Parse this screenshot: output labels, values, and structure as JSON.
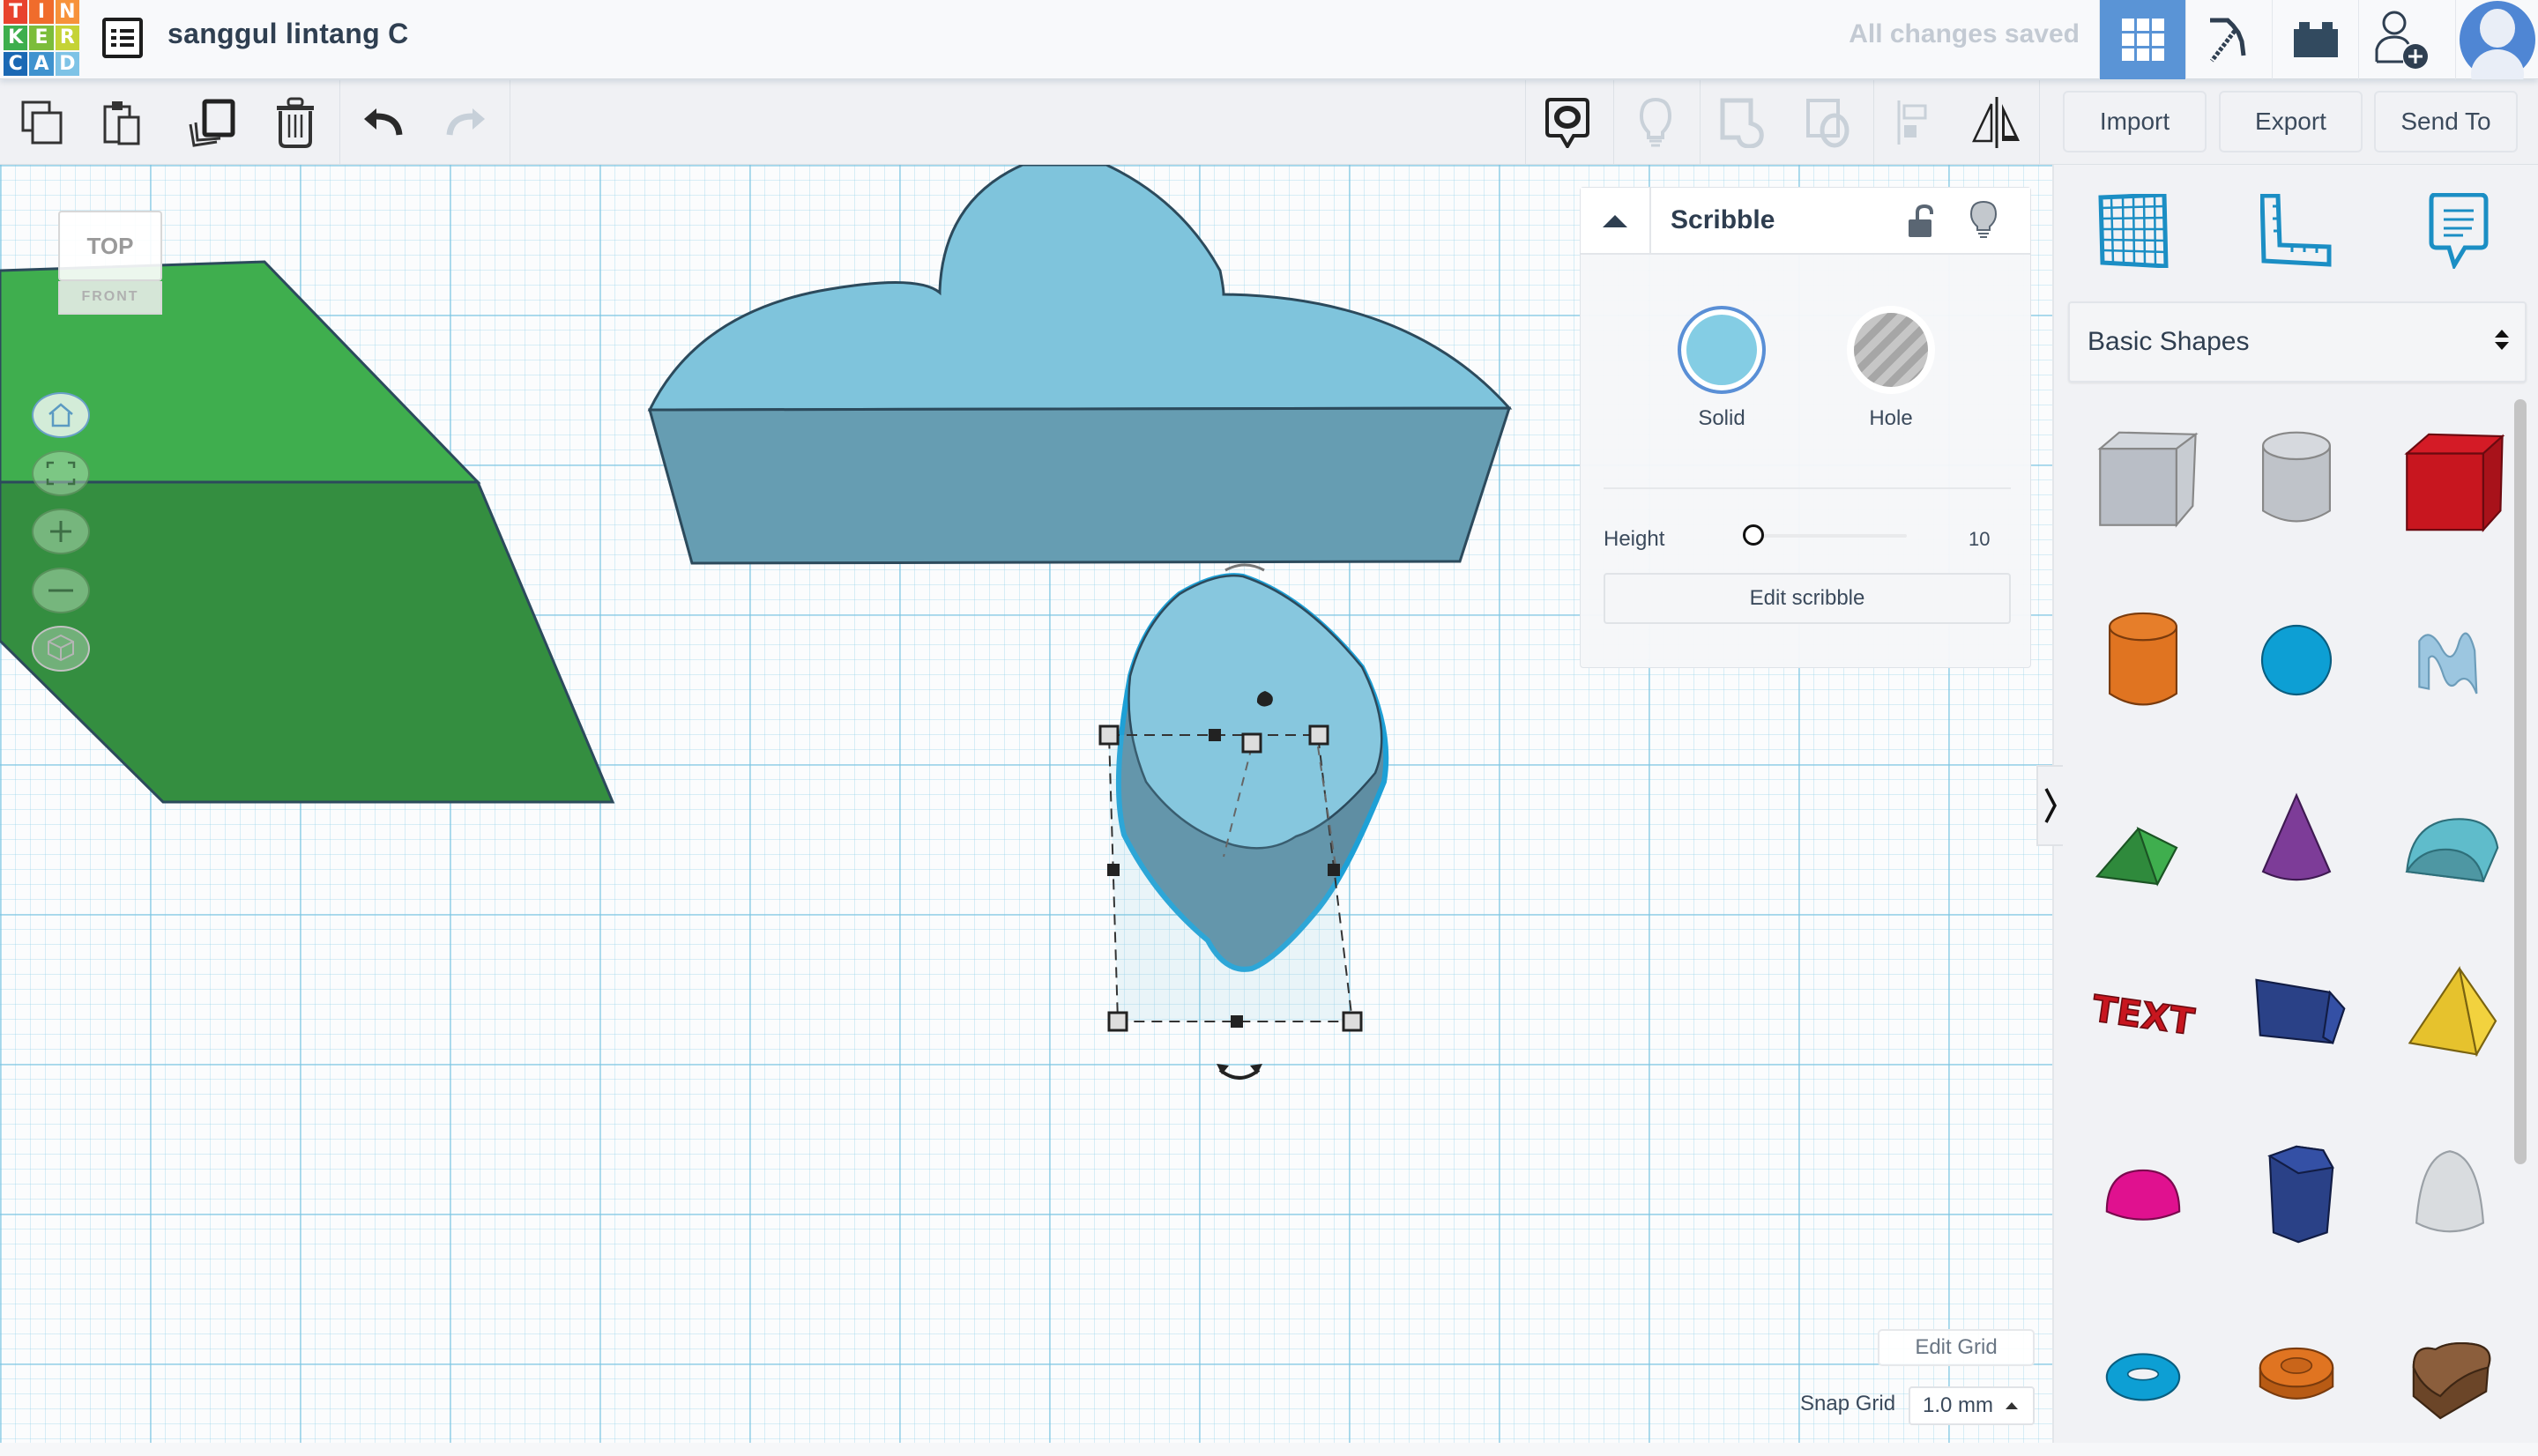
{
  "app": {
    "logo_letters": [
      "T",
      "I",
      "N",
      "K",
      "E",
      "R",
      "C",
      "A",
      "D"
    ],
    "logo_colors": [
      "#e8432e",
      "#f06c2c",
      "#f7923a",
      "#3dae4d",
      "#7cbd3b",
      "#c5d336",
      "#1a68b4",
      "#3f93cf",
      "#7ec3e6"
    ],
    "design_title": "sanggul lintang C",
    "save_status": "All changes saved",
    "accent_color": "#5a94d6"
  },
  "header_buttons": [
    {
      "name": "3d-design-view",
      "icon": "grid-icon",
      "active": true
    },
    {
      "name": "blocks-view",
      "icon": "pickaxe-icon",
      "active": false
    },
    {
      "name": "bricks-view",
      "icon": "brick-icon",
      "active": false
    },
    {
      "name": "invite-user",
      "icon": "add-user-icon",
      "active": false
    },
    {
      "name": "profile",
      "icon": "avatar-icon",
      "active": false
    }
  ],
  "toolbar": {
    "left_tools": [
      {
        "name": "copy",
        "icon": "copy-icon",
        "enabled": true
      },
      {
        "name": "paste",
        "icon": "paste-icon",
        "enabled": true
      },
      {
        "name": "duplicate",
        "icon": "duplicate-icon",
        "enabled": true
      },
      {
        "name": "delete",
        "icon": "trash-icon",
        "enabled": true
      },
      {
        "name": "undo",
        "icon": "undo-icon",
        "enabled": true
      },
      {
        "name": "redo",
        "icon": "redo-icon",
        "enabled": false
      }
    ],
    "right_tools": [
      {
        "name": "notes",
        "icon": "note-eye-icon",
        "enabled": true
      },
      {
        "name": "show-all",
        "icon": "lightbulb-icon",
        "enabled": false
      },
      {
        "name": "group",
        "icon": "group-icon",
        "enabled": false
      },
      {
        "name": "ungroup",
        "icon": "ungroup-icon",
        "enabled": false
      },
      {
        "name": "align",
        "icon": "align-icon",
        "enabled": false
      },
      {
        "name": "mirror",
        "icon": "mirror-icon",
        "enabled": true
      }
    ],
    "import_label": "Import",
    "export_label": "Export",
    "send_to_label": "Send To"
  },
  "viewcube": {
    "top_label": "TOP",
    "front_label": "FRONT"
  },
  "view_controls": [
    {
      "name": "home-view",
      "icon": "home-icon"
    },
    {
      "name": "fit-view",
      "icon": "fit-icon"
    },
    {
      "name": "zoom-in",
      "icon": "plus-icon"
    },
    {
      "name": "zoom-out",
      "icon": "minus-icon"
    },
    {
      "name": "ortho-view",
      "icon": "cube-icon"
    }
  ],
  "inspector": {
    "shape_name": "Scribble",
    "solid_label": "Solid",
    "hole_label": "Hole",
    "solid_color": "#84cde4",
    "selected_mode": "Solid",
    "height_label": "Height",
    "height_value": "10",
    "height_slider_fraction": 0.0,
    "edit_button_label": "Edit scribble",
    "locked": false
  },
  "grid_controls": {
    "edit_grid_label": "Edit Grid",
    "snap_grid_label": "Snap Grid",
    "snap_grid_value": "1.0 mm"
  },
  "shapes_panel": {
    "top_icons": [
      {
        "name": "workplane",
        "icon": "workplane-icon"
      },
      {
        "name": "ruler",
        "icon": "ruler-icon"
      },
      {
        "name": "notes",
        "icon": "note-icon"
      }
    ],
    "library": "Basic Shapes",
    "shapes": [
      {
        "name": "Box Hole",
        "color": "#b9bec6",
        "kind": "box-hole"
      },
      {
        "name": "Cylinder Hole",
        "color": "#bfc3c9",
        "kind": "cylinder-hole"
      },
      {
        "name": "Box",
        "color": "#c8161f",
        "kind": "box"
      },
      {
        "name": "Cylinder",
        "color": "#e07421",
        "kind": "cylinder"
      },
      {
        "name": "Sphere",
        "color": "#0d9fd4",
        "kind": "sphere"
      },
      {
        "name": "Scribble",
        "color": "#9cc6e0",
        "kind": "scribble"
      },
      {
        "name": "Roof",
        "color": "#3fae4e",
        "kind": "roof"
      },
      {
        "name": "Cone",
        "color": "#7d3c98",
        "kind": "cone"
      },
      {
        "name": "Round Roof",
        "color": "#5fbccb",
        "kind": "round-roof"
      },
      {
        "name": "Text",
        "color": "#c8161f",
        "kind": "text"
      },
      {
        "name": "Wedge",
        "color": "#2a4187",
        "kind": "wedge"
      },
      {
        "name": "Pyramid",
        "color": "#e6c22d",
        "kind": "pyramid"
      },
      {
        "name": "Half Sphere",
        "color": "#e0118f",
        "kind": "half-sphere"
      },
      {
        "name": "Polygon",
        "color": "#2a4187",
        "kind": "polygon"
      },
      {
        "name": "Paraboloid",
        "color": "#d9dcdf",
        "kind": "paraboloid"
      },
      {
        "name": "Torus",
        "color": "#0d9fd4",
        "kind": "torus"
      },
      {
        "name": "Tube",
        "color": "#e07421",
        "kind": "tube"
      },
      {
        "name": "Heart",
        "color": "#8b5e3c",
        "kind": "heart"
      }
    ]
  },
  "scene": {
    "objects": [
      {
        "name": "green-roof-shape",
        "color": "#3fae4e",
        "selected": false
      },
      {
        "name": "blue-crown-shape",
        "color": "#7fc4dc",
        "selected": false
      },
      {
        "name": "scribble-shape",
        "color": "#87c7de",
        "selected": true
      }
    ]
  }
}
